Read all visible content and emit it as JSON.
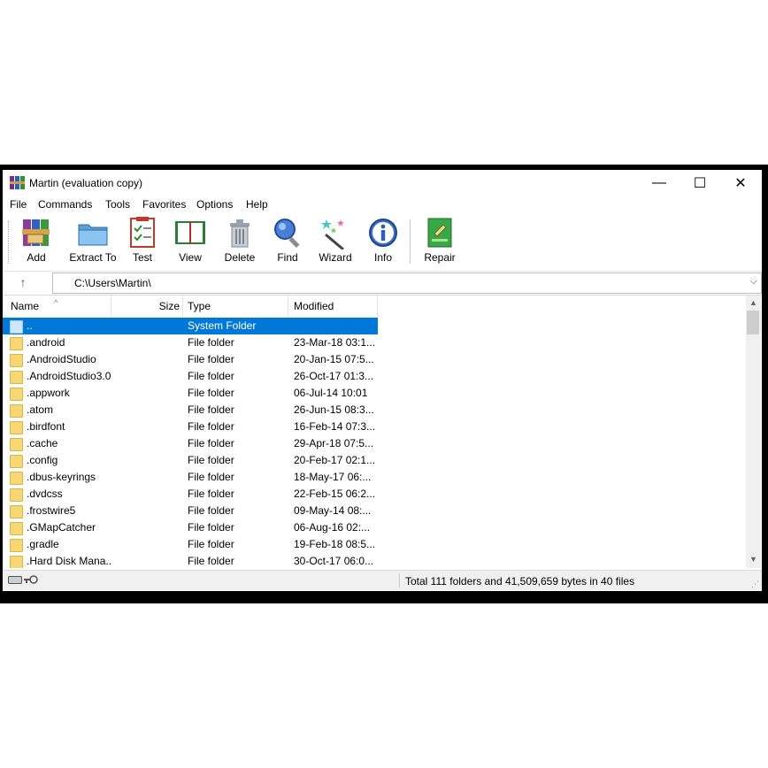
{
  "window": {
    "title": "Martin (evaluation copy)",
    "min": "—",
    "max": "☐",
    "close": "✕"
  },
  "menu": [
    "File",
    "Commands",
    "Tools",
    "Favorites",
    "Options",
    "Help"
  ],
  "toolbar": [
    "Add",
    "Extract To",
    "Test",
    "View",
    "Delete",
    "Find",
    "Wizard",
    "Info",
    "Repair"
  ],
  "address": {
    "path": "C:\\Users\\Martin\\",
    "up": "↑",
    "chevron": "⌵"
  },
  "columns": {
    "name": "Name",
    "size": "Size",
    "type": "Type",
    "modified": "Modified",
    "sort_glyph": "^"
  },
  "rows": [
    {
      "name": "..",
      "type": "System Folder",
      "modified": ""
    },
    {
      "name": ".android",
      "type": "File folder",
      "modified": "23-Mar-18 03:1..."
    },
    {
      "name": ".AndroidStudio",
      "type": "File folder",
      "modified": "20-Jan-15 07:5..."
    },
    {
      "name": ".AndroidStudio3.0",
      "type": "File folder",
      "modified": "26-Oct-17 01:3..."
    },
    {
      "name": ".appwork",
      "type": "File folder",
      "modified": "06-Jul-14 10:01"
    },
    {
      "name": ".atom",
      "type": "File folder",
      "modified": "26-Jun-15 08:3..."
    },
    {
      "name": ".birdfont",
      "type": "File folder",
      "modified": "16-Feb-14 07:3..."
    },
    {
      "name": ".cache",
      "type": "File folder",
      "modified": "29-Apr-18 07:5..."
    },
    {
      "name": ".config",
      "type": "File folder",
      "modified": "20-Feb-17 02:1..."
    },
    {
      "name": ".dbus-keyrings",
      "type": "File folder",
      "modified": "18-May-17 06:..."
    },
    {
      "name": ".dvdcss",
      "type": "File folder",
      "modified": "22-Feb-15 06:2..."
    },
    {
      "name": ".frostwire5",
      "type": "File folder",
      "modified": "09-May-14 08:..."
    },
    {
      "name": ".GMapCatcher",
      "type": "File folder",
      "modified": "06-Aug-16 02:..."
    },
    {
      "name": ".gradle",
      "type": "File folder",
      "modified": "19-Feb-18 08:5..."
    },
    {
      "name": ".Hard Disk Mana...",
      "type": "File folder",
      "modified": "30-Oct-17 06:0..."
    }
  ],
  "scroll": {
    "up": "▲",
    "down": "▼"
  },
  "status": {
    "text": "Total 111 folders and 41,509,659 bytes in 40 files"
  }
}
